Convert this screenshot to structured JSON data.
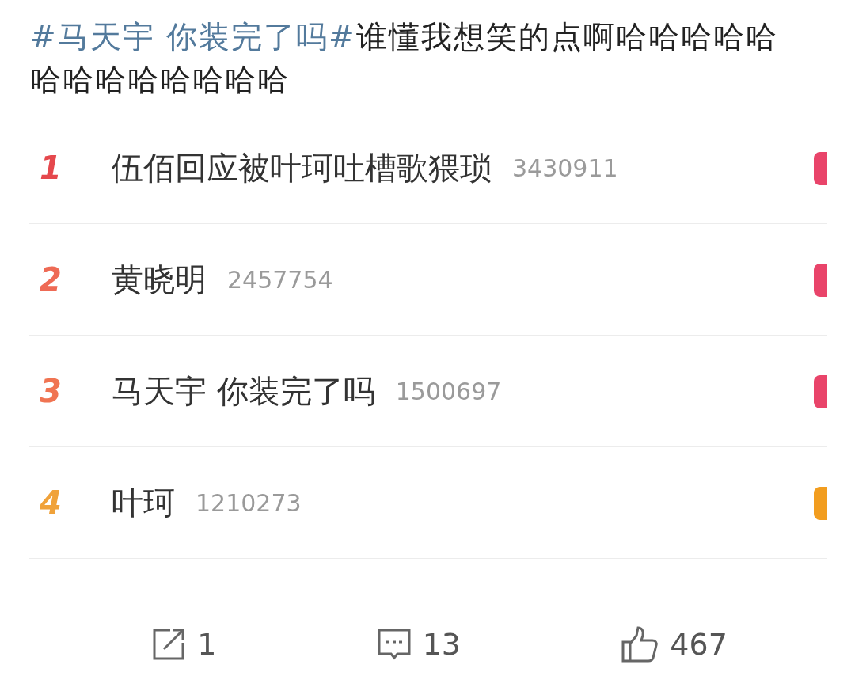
{
  "post": {
    "hashtag": "#马天宇 你装完了吗#",
    "text": "谁懂我想笑的点啊哈哈哈哈哈哈哈哈哈哈哈哈哈"
  },
  "ranking": [
    {
      "rank": "1",
      "color": "#e5484d",
      "title": "伍佰回应被叶珂吐槽歌猥琐",
      "count": "3430911",
      "badge": {
        "color": "#e9446a"
      }
    },
    {
      "rank": "2",
      "color": "#ee6a55",
      "title": "黄晓明",
      "count": "2457754",
      "badge": {
        "color": "#e9446a"
      }
    },
    {
      "rank": "3",
      "color": "#f07452",
      "title": "马天宇 你装完了吗",
      "count": "1500697",
      "badge": {
        "color": "#e9446a"
      }
    },
    {
      "rank": "4",
      "color": "#f0a23a",
      "title": "叶珂",
      "count": "1210273",
      "badge": {
        "color": "#f29d1f"
      }
    }
  ],
  "actions": [
    {
      "kind": "share",
      "count": "1"
    },
    {
      "kind": "comment",
      "count": "13"
    },
    {
      "kind": "like",
      "count": "467"
    }
  ]
}
